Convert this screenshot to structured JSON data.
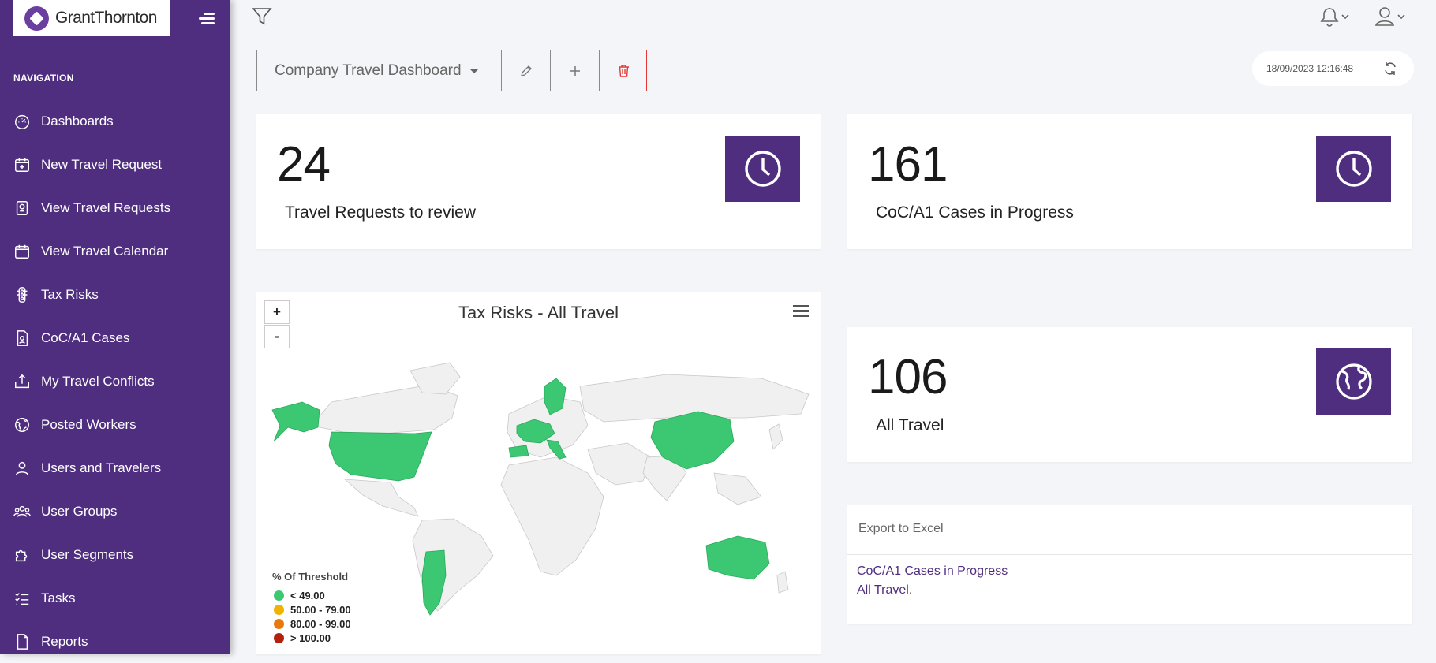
{
  "brand": {
    "name": "GrantThornton",
    "accent": "#4f2d7f",
    "map_green": "#3cc873"
  },
  "sidebar": {
    "nav_title": "NAVIGATION",
    "items": [
      {
        "label": "Dashboards",
        "icon": "speedometer-icon"
      },
      {
        "label": "New Travel Request",
        "icon": "calendar-plus-icon"
      },
      {
        "label": "View Travel Requests",
        "icon": "passport-icon"
      },
      {
        "label": "View Travel Calendar",
        "icon": "calendar-icon"
      },
      {
        "label": "Tax Risks",
        "icon": "traffic-light-icon"
      },
      {
        "label": "CoC/A1 Cases",
        "icon": "document-person-icon"
      },
      {
        "label": "My Travel Conflicts",
        "icon": "upload-alert-icon"
      },
      {
        "label": "Posted Workers",
        "icon": "globe-person-icon"
      },
      {
        "label": "Users and Travelers",
        "icon": "user-icon"
      },
      {
        "label": "User Groups",
        "icon": "users-icon"
      },
      {
        "label": "User Segments",
        "icon": "puzzle-icon"
      },
      {
        "label": "Tasks",
        "icon": "checklist-icon"
      },
      {
        "label": "Reports",
        "icon": "file-icon"
      }
    ]
  },
  "toolbar": {
    "dashboard_name": "Company Travel Dashboard",
    "timestamp": "18/09/2023 12:16:48"
  },
  "cards": {
    "review": {
      "value": "24",
      "label": "Travel Requests to review"
    },
    "coc": {
      "value": "161",
      "label": "CoC/A1 Cases in Progress"
    },
    "all": {
      "value": "106",
      "label": "All Travel"
    }
  },
  "map": {
    "title": "Tax Risks - All Travel",
    "zoom_in": "+",
    "zoom_out": "-",
    "legend_title": "% Of Threshold",
    "legend": [
      {
        "label": "< 49.00",
        "color": "#3cc873"
      },
      {
        "label": "50.00 - 79.00",
        "color": "#f0b400"
      },
      {
        "label": "80.00 - 99.00",
        "color": "#e8790a"
      },
      {
        "label": "> 100.00",
        "color": "#b3200e"
      }
    ]
  },
  "export": {
    "title": "Export to Excel",
    "links": [
      "CoC/A1 Cases in Progress",
      "All Travel"
    ],
    "trailing": "."
  }
}
